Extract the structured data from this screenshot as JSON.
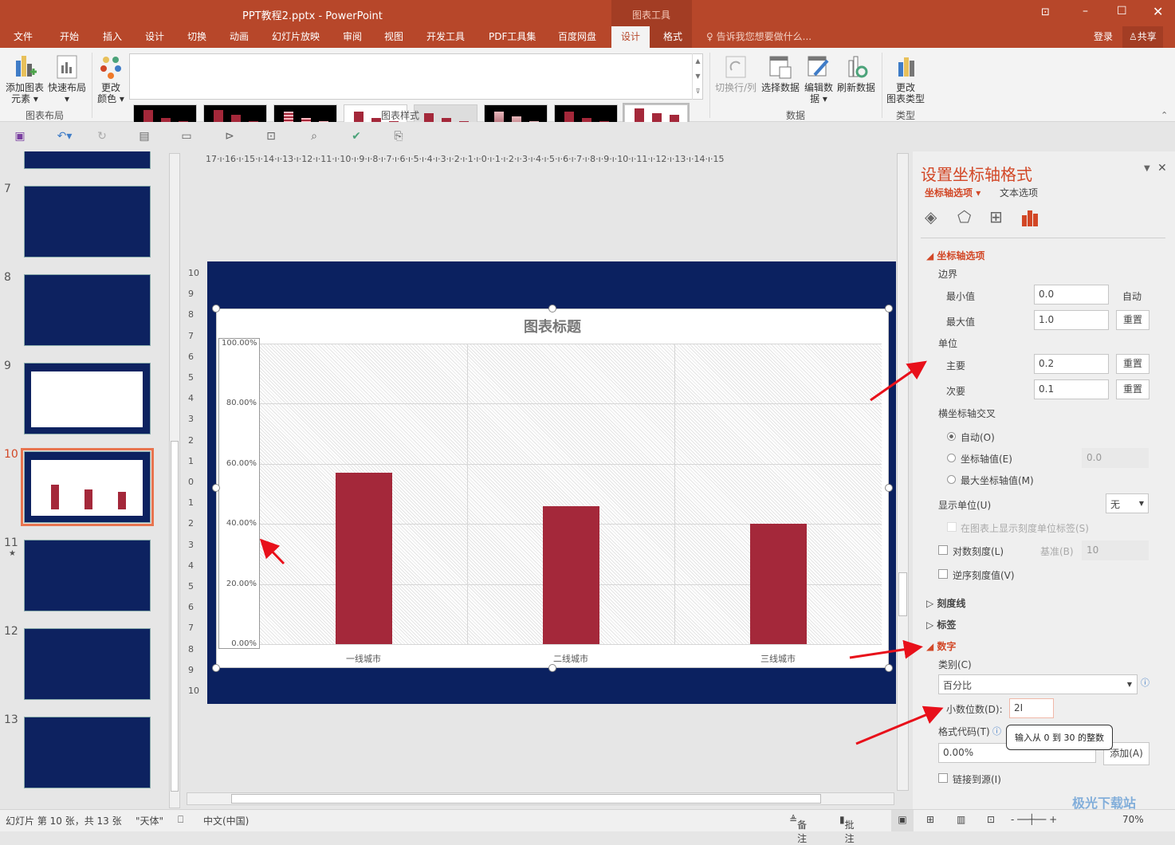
{
  "window": {
    "title": "PPT教程2.pptx - PowerPoint",
    "context_tab": "图表工具",
    "login": "登录",
    "share": "共享"
  },
  "tabs": [
    "文件",
    "开始",
    "插入",
    "设计",
    "切换",
    "动画",
    "幻灯片放映",
    "审阅",
    "视图",
    "开发工具",
    "PDF工具集",
    "百度网盘",
    "设计",
    "格式"
  ],
  "active_tab": "设计",
  "tell_me": "告诉我您想要做什么...",
  "ribbon": {
    "layout": {
      "add_element": "添加图表",
      "add_element2": "元素",
      "quick_layout": "快速布局",
      "label": "图表布局"
    },
    "colors": {
      "l1": "更改",
      "l2": "颜色"
    },
    "styles_label": "图表样式",
    "data": {
      "switch": "切换行/列",
      "select": "选择数据",
      "edit": "编辑数",
      "edit2": "据",
      "refresh": "刷新数据",
      "label": "数据"
    },
    "type": {
      "l1": "更改",
      "l2": "图表类型",
      "label": "类型"
    }
  },
  "slides": [
    {
      "num": "7"
    },
    {
      "num": "8"
    },
    {
      "num": "9"
    },
    {
      "num": "10",
      "selected": true
    },
    {
      "num": "11",
      "star": "★"
    },
    {
      "num": "12"
    },
    {
      "num": "13"
    }
  ],
  "ruler": {
    "h": "17·ı·16·ı·15·ı·14·ı·13·ı·12·ı·11·ı·10·ı·9·ı·8·ı·7·ı·6·ı·5·ı·4·ı·3·ı·2·ı·1·ı·0·ı·1·ı·2·ı·3·ı·4·ı·5·ı·6·ı·7·ı·8·ı·9·ı·10·ı·11·ı·12·ı·13·ı·14·ı·15"
  },
  "chart_data": {
    "type": "bar",
    "title": "图表标题",
    "categories": [
      "一线城市",
      "二线城市",
      "三线城市"
    ],
    "values": [
      0.57,
      0.46,
      0.4
    ],
    "ylim": [
      0,
      1
    ],
    "yticks": [
      "0.00%",
      "20.00%",
      "40.00%",
      "60.00%",
      "80.00%",
      "100.00%"
    ],
    "grid": true,
    "bar_color": "#a4283a"
  },
  "panel": {
    "title": "设置坐标轴格式",
    "tab_axis": "坐标轴选项",
    "tab_text": "文本选项",
    "sec_axis": "坐标轴选项",
    "bounds": "边界",
    "min_label": "最小值",
    "min_value": "0.0",
    "min_auto": "自动",
    "max_label": "最大值",
    "max_value": "1.0",
    "reset": "重置",
    "units": "单位",
    "major_label": "主要",
    "major_value": "0.2",
    "minor_label": "次要",
    "minor_value": "0.1",
    "cross": "横坐标轴交叉",
    "r_auto": "自动(O)",
    "r_value": "坐标轴值(E)",
    "r_value_input": "0.0",
    "r_max": "最大坐标轴值(M)",
    "display_units": "显示单位(U)",
    "display_units_value": "无",
    "show_units_label": "在图表上显示刻度单位标签(S)",
    "log": "对数刻度(L)",
    "base": "基准(B)",
    "base_value": "10",
    "reverse": "逆序刻度值(V)",
    "tick_marks": "刻度线",
    "labels": "标签",
    "number": "数字",
    "category": "类别(C)",
    "category_value": "百分比",
    "decimals": "小数位数(D):",
    "decimals_value": "2",
    "tooltip": "输入从 0 到 30 的整数",
    "format_code": "格式代码(T)",
    "format_code_value": "0.00%",
    "add": "添加(A)",
    "link": "链接到源(I)"
  },
  "status": {
    "slide": "幻灯片 第 10 张，共 13 张",
    "theme": "\"天体\"",
    "lang": "中文(中国)",
    "notes": "备注",
    "comments": "批注",
    "zoom": "70%"
  },
  "watermark": "极光下载站 www.xz7.com"
}
